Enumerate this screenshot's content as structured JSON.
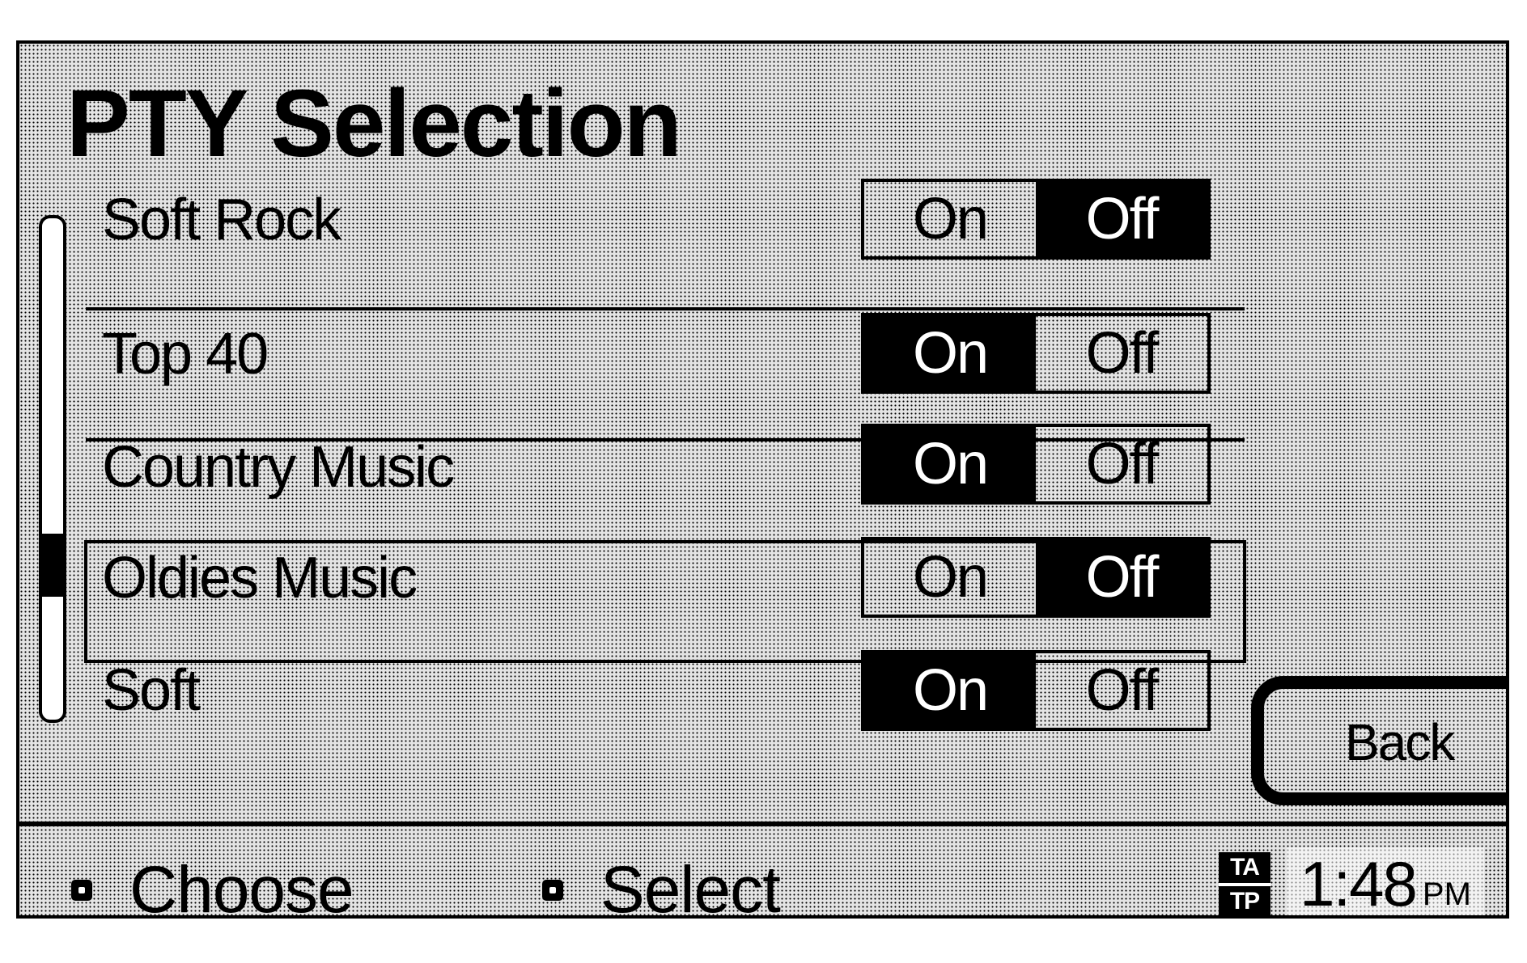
{
  "title": "PTY Selection",
  "scrollbar": {
    "position": 0.72
  },
  "rows": [
    {
      "label": "Soft Rock",
      "on_label": "On",
      "off_label": "Off",
      "selected": "Off"
    },
    {
      "label": "Top 40",
      "on_label": "On",
      "off_label": "Off",
      "selected": "On"
    },
    {
      "label": "Country Music",
      "on_label": "On",
      "off_label": "Off",
      "selected": "On"
    },
    {
      "label": "Oldies Music",
      "on_label": "On",
      "off_label": "Off",
      "selected": "Off",
      "focused": true
    },
    {
      "label": "Soft",
      "on_label": "On",
      "off_label": "Off",
      "selected": "On"
    }
  ],
  "back_button": {
    "label": "Back"
  },
  "status_bar": {
    "choose_label": "Choose",
    "select_label": "Select",
    "ta_label": "TA",
    "tp_label": "TP",
    "time": "1:48",
    "ampm": "PM"
  }
}
